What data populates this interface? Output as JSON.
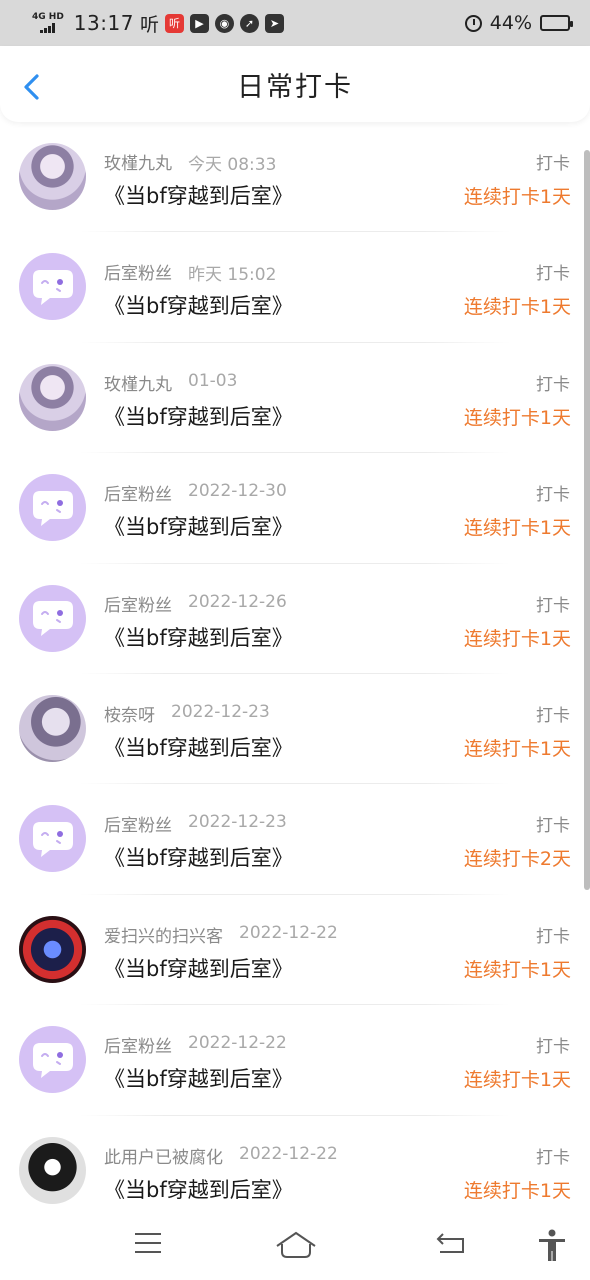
{
  "status_bar": {
    "network": "4G HD",
    "time": "13:17",
    "listen_label": "听",
    "app_badge": "听",
    "battery": "44%",
    "battery_level": 0.44
  },
  "header": {
    "title": "日常打卡"
  },
  "checkins": [
    {
      "user": "玫槿九丸",
      "date": "今天 08:33",
      "book": "《当bf穿越到后室》",
      "action": "打卡",
      "streak": "连续打卡1天",
      "avatar": "anime-girl-avatar"
    },
    {
      "user": "后室粉丝",
      "date": "昨天 15:02",
      "book": "《当bf穿越到后室》",
      "action": "打卡",
      "streak": "连续打卡1天",
      "avatar": "default-bubble-avatar"
    },
    {
      "user": "玫槿九丸",
      "date": "01-03",
      "book": "《当bf穿越到后室》",
      "action": "打卡",
      "streak": "连续打卡1天",
      "avatar": "anime-girl-avatar"
    },
    {
      "user": "后室粉丝",
      "date": "2022-12-30",
      "book": "《当bf穿越到后室》",
      "action": "打卡",
      "streak": "连续打卡1天",
      "avatar": "default-bubble-avatar"
    },
    {
      "user": "后室粉丝",
      "date": "2022-12-26",
      "book": "《当bf穿越到后室》",
      "action": "打卡",
      "streak": "连续打卡1天",
      "avatar": "default-bubble-avatar"
    },
    {
      "user": "桉奈呀",
      "date": "2022-12-23",
      "book": "《当bf穿越到后室》",
      "action": "打卡",
      "streak": "连续打卡1天",
      "avatar": "anime-girl-avatar"
    },
    {
      "user": "后室粉丝",
      "date": "2022-12-23",
      "book": "《当bf穿越到后室》",
      "action": "打卡",
      "streak": "连续打卡2天",
      "avatar": "default-bubble-avatar"
    },
    {
      "user": "爱扫兴的扫兴客",
      "date": "2022-12-22",
      "book": "《当bf穿越到后室》",
      "action": "打卡",
      "streak": "连续打卡1天",
      "avatar": "hooded-figure-avatar"
    },
    {
      "user": "后室粉丝",
      "date": "2022-12-22",
      "book": "《当bf穿越到后室》",
      "action": "打卡",
      "streak": "连续打卡1天",
      "avatar": "default-bubble-avatar"
    },
    {
      "user": "此用户已被腐化",
      "date": "2022-12-22",
      "book": "《当bf穿越到后室》",
      "action": "打卡",
      "streak": "连续打卡1天",
      "avatar": "sketch-character-avatar"
    }
  ],
  "colors": {
    "accent_blue": "#2f8ff0",
    "streak_orange": "#ee7a2f",
    "default_avatar_bg": "#d5c1f5"
  },
  "bottom_nav": [
    "menu-icon",
    "home-icon",
    "back-icon",
    "accessibility-icon"
  ]
}
